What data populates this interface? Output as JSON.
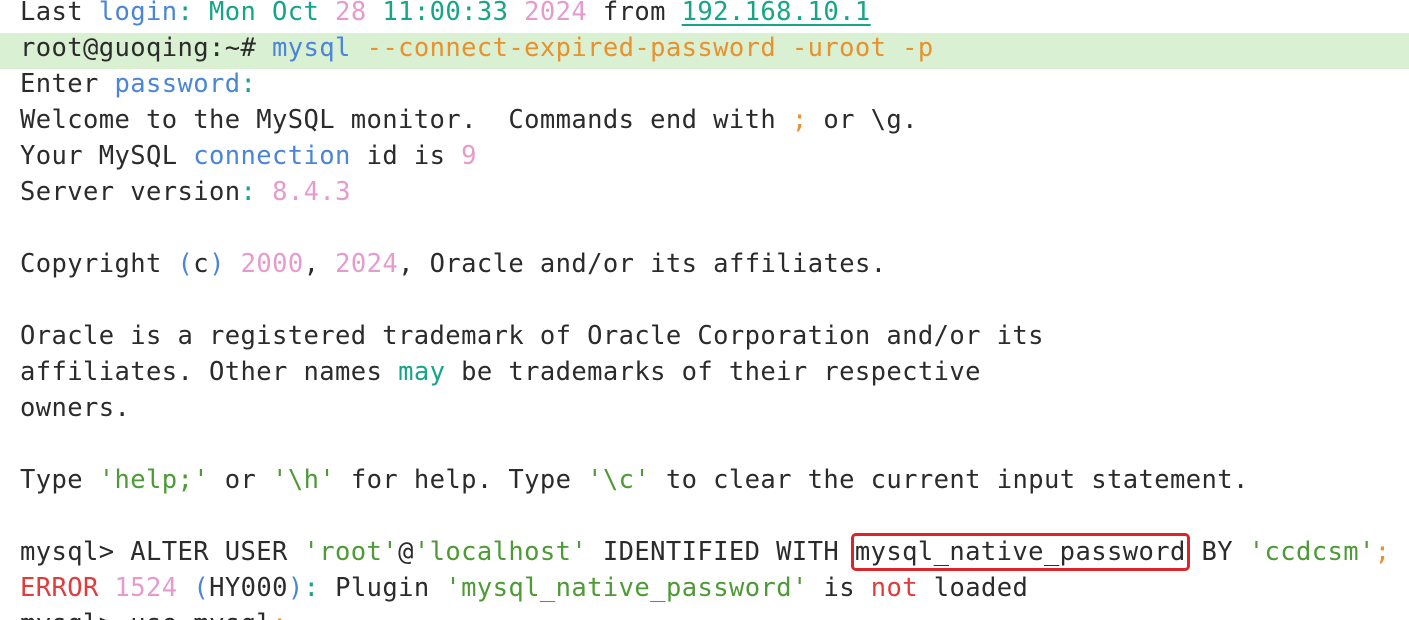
{
  "colors": {
    "default": "#2b2b2b",
    "blue": "#4a86d8",
    "teal": "#17a589",
    "orange": "#e8912d",
    "pink": "#e79bcd",
    "green": "#4e9a36",
    "red": "#e03c3c",
    "highlight_line_bg": "#d9f0d3",
    "annotation_box": "#d9262a"
  },
  "terminal": {
    "lines": [
      [
        {
          "text": "Last "
        },
        {
          "text": "login",
          "color": "blue"
        },
        {
          "text": ": ",
          "color": "teal"
        },
        {
          "text": "Mon Oct ",
          "color": "teal"
        },
        {
          "text": "28",
          "color": "pink"
        },
        {
          "text": " 11:00:33 ",
          "color": "teal"
        },
        {
          "text": "2024",
          "color": "pink"
        },
        {
          "text": " from "
        },
        {
          "text": "192.168.10.1",
          "color": "teal",
          "link": true
        }
      ],
      [
        {
          "text": "root@guoqing:~# "
        },
        {
          "text": "mysql",
          "color": "blue"
        },
        {
          "text": " --connect-expired-password -uroot -p",
          "color": "orange"
        }
      ],
      [
        {
          "text": "Enter "
        },
        {
          "text": "password",
          "color": "blue"
        },
        {
          "text": ":",
          "color": "teal"
        }
      ],
      [
        {
          "text": "Welcome to the MySQL monitor.  Commands end with "
        },
        {
          "text": ";",
          "color": "orange"
        },
        {
          "text": " or \\g."
        }
      ],
      [
        {
          "text": "Your MySQL "
        },
        {
          "text": "connection",
          "color": "blue"
        },
        {
          "text": " id is "
        },
        {
          "text": "9",
          "color": "pink"
        }
      ],
      [
        {
          "text": "Server version"
        },
        {
          "text": ": ",
          "color": "teal"
        },
        {
          "text": "8.4.3",
          "color": "pink"
        }
      ],
      [],
      [
        {
          "text": "Copyright "
        },
        {
          "text": "(",
          "color": "blue"
        },
        {
          "text": "c"
        },
        {
          "text": ")",
          "color": "blue"
        },
        {
          "text": " "
        },
        {
          "text": "2000",
          "color": "pink"
        },
        {
          "text": ", "
        },
        {
          "text": "2024",
          "color": "pink"
        },
        {
          "text": ", Oracle and/or its affiliates."
        }
      ],
      [],
      [
        {
          "text": "Oracle is a registered trademark of Oracle Corporation and/or its"
        }
      ],
      [
        {
          "text": "affiliates. Other names "
        },
        {
          "text": "may",
          "color": "teal"
        },
        {
          "text": " be trademarks of their respective"
        }
      ],
      [
        {
          "text": "owners."
        }
      ],
      [],
      [
        {
          "text": "Type "
        },
        {
          "text": "'help;'",
          "color": "green"
        },
        {
          "text": " or "
        },
        {
          "text": "'\\h'",
          "color": "green"
        },
        {
          "text": " for help. Type "
        },
        {
          "text": "'\\c'",
          "color": "green"
        },
        {
          "text": " to clear the current input statement."
        }
      ],
      [],
      [
        {
          "text": "mysql> ALTER USER "
        },
        {
          "text": "'root'",
          "color": "green"
        },
        {
          "text": "@"
        },
        {
          "text": "'localhost'",
          "color": "green"
        },
        {
          "text": " IDENTIFIED WITH "
        },
        {
          "text": "mysql_native_password",
          "boxed": true
        },
        {
          "text": " BY "
        },
        {
          "text": "'ccdcsm'",
          "color": "green"
        },
        {
          "text": ";",
          "color": "orange"
        }
      ],
      [
        {
          "text": "ERROR",
          "color": "red"
        },
        {
          "text": " "
        },
        {
          "text": "1524",
          "color": "pink"
        },
        {
          "text": " "
        },
        {
          "text": "(",
          "color": "blue"
        },
        {
          "text": "HY000"
        },
        {
          "text": ")",
          "color": "blue"
        },
        {
          "text": ": ",
          "color": "teal"
        },
        {
          "text": "Plugin "
        },
        {
          "text": "'mysql_native_password'",
          "color": "green"
        },
        {
          "text": " is "
        },
        {
          "text": "not",
          "color": "red"
        },
        {
          "text": " loaded"
        }
      ],
      [
        {
          "text": "mysql> use mysql"
        },
        {
          "text": ";",
          "color": "orange"
        }
      ]
    ],
    "highlighted_line_index": 1
  }
}
